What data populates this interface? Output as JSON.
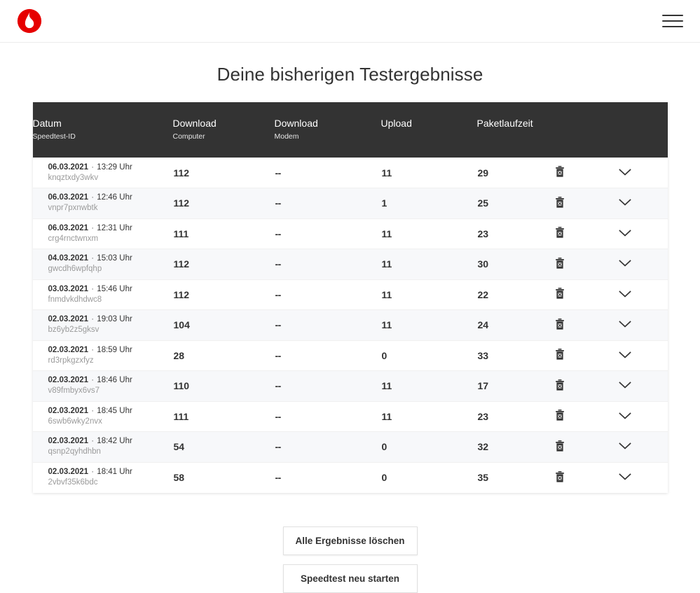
{
  "header": {
    "logo_alt": "Vodafone",
    "logo_color": "#e60000",
    "menu_label": "Menü"
  },
  "page": {
    "title": "Deine bisherigen Testergebnisse"
  },
  "table": {
    "columns": [
      {
        "main": "Datum",
        "sub": "Speedtest-ID"
      },
      {
        "main": "Download",
        "sub": "Computer"
      },
      {
        "main": "Download",
        "sub": "Modem"
      },
      {
        "main": "Upload",
        "sub": ""
      },
      {
        "main": "Paketlaufzeit",
        "sub": ""
      },
      {
        "main": "",
        "sub": ""
      },
      {
        "main": "",
        "sub": ""
      }
    ],
    "header_bg": "#333333",
    "row_alt_bg": "#f7f8fa",
    "time_suffix": "Uhr",
    "delete_icon": "trash-icon",
    "expand_icon": "chevron-down-icon",
    "rows": [
      {
        "date": "06.03.2021",
        "time": "13:29",
        "id": "knqztxdy3wkv",
        "download_computer": "112",
        "download_modem": "--",
        "upload": "11",
        "ping": "29"
      },
      {
        "date": "06.03.2021",
        "time": "12:46",
        "id": "vnpr7pxnwbtk",
        "download_computer": "112",
        "download_modem": "--",
        "upload": "1",
        "ping": "25"
      },
      {
        "date": "06.03.2021",
        "time": "12:31",
        "id": "crg4rnctwnxm",
        "download_computer": "111",
        "download_modem": "--",
        "upload": "11",
        "ping": "23"
      },
      {
        "date": "04.03.2021",
        "time": "15:03",
        "id": "gwcdh6wpfqhp",
        "download_computer": "112",
        "download_modem": "--",
        "upload": "11",
        "ping": "30"
      },
      {
        "date": "03.03.2021",
        "time": "15:46",
        "id": "fnmdvkdhdwc8",
        "download_computer": "112",
        "download_modem": "--",
        "upload": "11",
        "ping": "22"
      },
      {
        "date": "02.03.2021",
        "time": "19:03",
        "id": "bz6yb2z5gksv",
        "download_computer": "104",
        "download_modem": "--",
        "upload": "11",
        "ping": "24"
      },
      {
        "date": "02.03.2021",
        "time": "18:59",
        "id": "rd3rpkgzxfyz",
        "download_computer": "28",
        "download_modem": "--",
        "upload": "0",
        "ping": "33"
      },
      {
        "date": "02.03.2021",
        "time": "18:46",
        "id": "v89fmbyx6vs7",
        "download_computer": "110",
        "download_modem": "--",
        "upload": "11",
        "ping": "17"
      },
      {
        "date": "02.03.2021",
        "time": "18:45",
        "id": "6swb6wky2nvx",
        "download_computer": "111",
        "download_modem": "--",
        "upload": "11",
        "ping": "23"
      },
      {
        "date": "02.03.2021",
        "time": "18:42",
        "id": "qsnp2qyhdhbn",
        "download_computer": "54",
        "download_modem": "--",
        "upload": "0",
        "ping": "32"
      },
      {
        "date": "02.03.2021",
        "time": "18:41",
        "id": "2vbvf35k6bdc",
        "download_computer": "58",
        "download_modem": "--",
        "upload": "0",
        "ping": "35"
      }
    ]
  },
  "actions": {
    "delete_all_label": "Alle Ergebnisse löschen",
    "restart_label": "Speedtest neu starten"
  }
}
